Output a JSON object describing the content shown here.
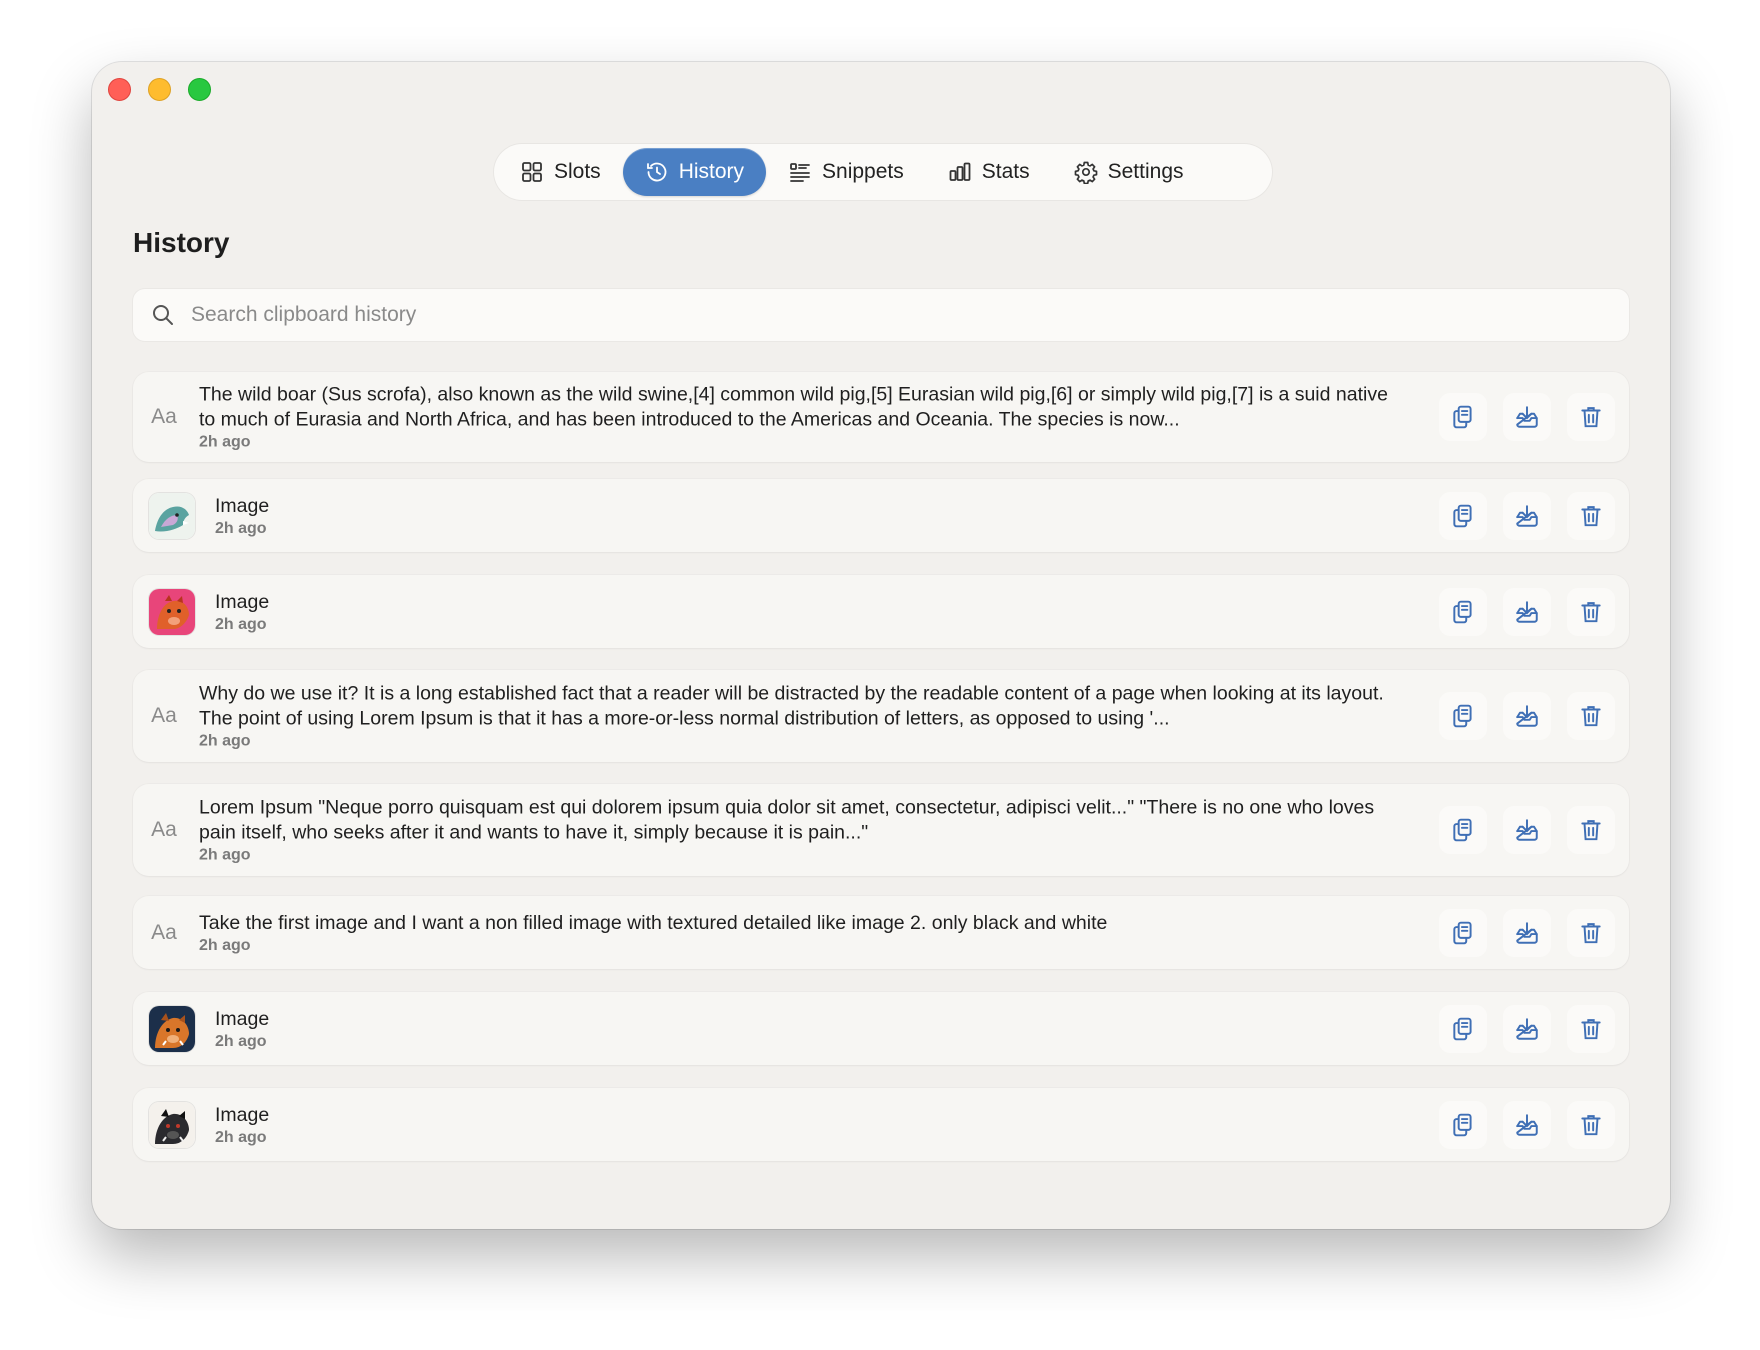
{
  "tabs": [
    {
      "label": "Slots",
      "icon": "grid-icon",
      "active": false
    },
    {
      "label": "History",
      "icon": "clock-history-icon",
      "active": true
    },
    {
      "label": "Snippets",
      "icon": "list-snippets-icon",
      "active": false
    },
    {
      "label": "Stats",
      "icon": "bar-chart-icon",
      "active": false
    },
    {
      "label": "Settings",
      "icon": "gear-icon",
      "active": false
    }
  ],
  "page": {
    "title": "History"
  },
  "search": {
    "placeholder": "Search clipboard history",
    "value": ""
  },
  "items": [
    {
      "kind": "text",
      "type_icon": "Aa",
      "text": "The wild boar (Sus scrofa), also known as the wild swine,[4] common wild pig,[5] Eurasian wild pig,[6] or simply wild pig,[7] is a suid native to much of Eurasia and North Africa, and has been introduced to the Americas and Oceania. The species is now...",
      "time": "2h ago"
    },
    {
      "kind": "image",
      "label": "Image",
      "time": "2h ago",
      "thumb": "boar-thumb-teal"
    },
    {
      "kind": "image",
      "label": "Image",
      "time": "2h ago",
      "thumb": "boar-thumb-red"
    },
    {
      "kind": "text",
      "type_icon": "Aa",
      "text": "Why do we use it? It is a long established fact that a reader will be distracted by the readable content of a page when looking at its layout. The point of using Lorem Ipsum is that it has a more-or-less normal distribution of letters, as opposed to using '...",
      "time": "2h ago"
    },
    {
      "kind": "text",
      "type_icon": "Aa",
      "text": "Lorem Ipsum \"Neque porro quisquam est qui dolorem ipsum quia dolor sit amet, consectetur, adipisci velit...\" \"There is no one who loves pain itself, who seeks after it and wants to have it, simply because it is pain...\"",
      "time": "2h ago"
    },
    {
      "kind": "text",
      "type_icon": "Aa",
      "text": "Take the first image and I want a non filled image with textured detailed like image 2. only black and white",
      "time": "2h ago"
    },
    {
      "kind": "image",
      "label": "Image",
      "time": "2h ago",
      "thumb": "boar-thumb-orange"
    },
    {
      "kind": "image",
      "label": "Image",
      "time": "2h ago",
      "thumb": "boar-thumb-dark"
    }
  ],
  "actions": {
    "copy": "copy-icon",
    "save": "download-tray-icon",
    "delete": "trash-icon"
  },
  "colors": {
    "accent": "#4a7fc3",
    "window_bg": "#f2f0ed",
    "row_bg": "#f7f6f3"
  }
}
